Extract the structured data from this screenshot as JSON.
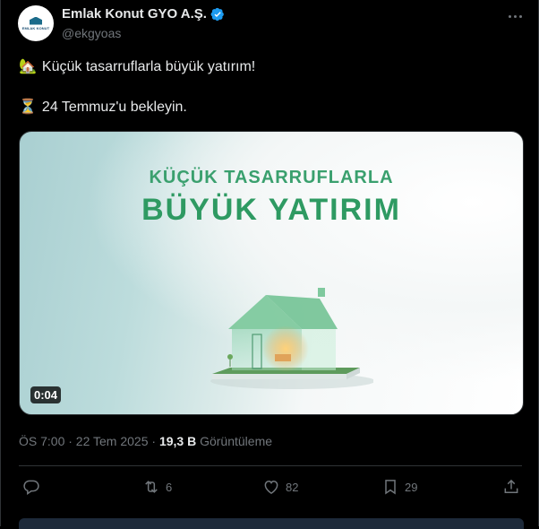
{
  "author": {
    "display_name": "Emlak Konut GYO A.Ş.",
    "handle": "@ekgyoas",
    "avatar_text": "EMLAK KONUT"
  },
  "tweet": {
    "line1_emoji": "🏡",
    "line1_text": "Küçük tasarruflarla büyük yatırım!",
    "line2_emoji": "⏳",
    "line2_text": "24 Temmuz'u bekleyin."
  },
  "media": {
    "title_small": "KÜÇÜK TASARRUFLARLA",
    "title_large": "BÜYÜK YATIRIM",
    "duration": "0:04"
  },
  "meta": {
    "time_date": "ÖS 7:00 · 22 Tem 2025 · ",
    "views_count": "19,3 B",
    "views_label": " Görüntüleme"
  },
  "actions": {
    "reply_count": "",
    "repost_count": "6",
    "like_count": "82",
    "bookmark_count": "29"
  },
  "colors": {
    "verified": "#1d9bf0",
    "brand_green": "#2e9a62",
    "muted": "#71767b"
  }
}
